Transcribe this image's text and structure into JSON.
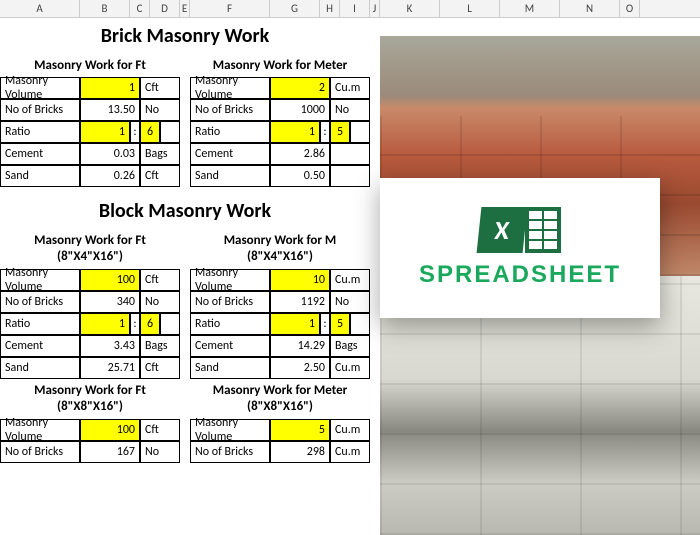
{
  "columns": [
    "A",
    "B",
    "C",
    "D",
    "E",
    "F",
    "G",
    "H",
    "I",
    "J",
    "K",
    "L",
    "M",
    "N",
    "O"
  ],
  "brick": {
    "title": "Brick Masonry Work",
    "ft": {
      "header": "Masonry Work for Ft",
      "rows": [
        {
          "label": "Masonry Volume",
          "value": "1",
          "unit": "Cft",
          "hl": true
        },
        {
          "label": "No of Bricks",
          "value": "13.50",
          "unit": "No",
          "hl": false
        },
        {
          "label": "Ratio",
          "value": "1",
          "unit": "6",
          "hl": true,
          "ratio": true
        },
        {
          "label": "Cement",
          "value": "0.03",
          "unit": "Bags",
          "hl": false
        },
        {
          "label": "Sand",
          "value": "0.26",
          "unit": "Cft",
          "hl": false
        }
      ]
    },
    "m": {
      "header": "Masonry Work for Meter",
      "rows": [
        {
          "label": "Masonry Volume",
          "value": "2",
          "unit": "Cu.m",
          "hl": true
        },
        {
          "label": "No of Bricks",
          "value": "1000",
          "unit": "No",
          "hl": false
        },
        {
          "label": "Ratio",
          "value": "1",
          "unit": "5",
          "hl": true,
          "ratio": true
        },
        {
          "label": "Cement",
          "value": "2.86",
          "unit": "",
          "hl": false
        },
        {
          "label": "Sand",
          "value": "0.50",
          "unit": "",
          "hl": false
        }
      ]
    }
  },
  "block": {
    "title": "Block Masonry Work",
    "ft4": {
      "header": "Masonry Work for Ft",
      "sub": "(8\"X4\"X16\")",
      "rows": [
        {
          "label": "Masonry Volume",
          "value": "100",
          "unit": "Cft",
          "hl": true
        },
        {
          "label": "No of Bricks",
          "value": "340",
          "unit": "No",
          "hl": false
        },
        {
          "label": "Ratio",
          "value": "1",
          "unit": "6",
          "hl": true,
          "ratio": true
        },
        {
          "label": "Cement",
          "value": "3.43",
          "unit": "Bags",
          "hl": false
        },
        {
          "label": "Sand",
          "value": "25.71",
          "unit": "Cft",
          "hl": false
        }
      ]
    },
    "m4": {
      "header": "Masonry Work for M",
      "sub": "(8\"X4\"X16\")",
      "rows": [
        {
          "label": "Masonry Volume",
          "value": "10",
          "unit": "Cu.m",
          "hl": true
        },
        {
          "label": "No of Bricks",
          "value": "1192",
          "unit": "No",
          "hl": false
        },
        {
          "label": "Ratio",
          "value": "1",
          "unit": "5",
          "hl": true,
          "ratio": true
        },
        {
          "label": "Cement",
          "value": "14.29",
          "unit": "Bags",
          "hl": false
        },
        {
          "label": "Sand",
          "value": "2.50",
          "unit": "Cu.m",
          "hl": false
        }
      ]
    },
    "ft8": {
      "header": "Masonry Work for Ft",
      "sub": "(8\"X8\"X16\")",
      "rows": [
        {
          "label": "Masonry Volume",
          "value": "100",
          "unit": "Cft",
          "hl": true
        },
        {
          "label": "No of Bricks",
          "value": "167",
          "unit": "No",
          "hl": false
        }
      ]
    },
    "m8": {
      "header": "Masonry Work for Meter",
      "sub": "(8\"X8\"X16\")",
      "rows": [
        {
          "label": "Masonry Volume",
          "value": "5",
          "unit": "Cu.m",
          "hl": true
        },
        {
          "label": "No of Bricks",
          "value": "298",
          "unit": "Cu.m",
          "hl": false
        }
      ]
    }
  },
  "overlay": {
    "text": "SPREADSHEET"
  }
}
